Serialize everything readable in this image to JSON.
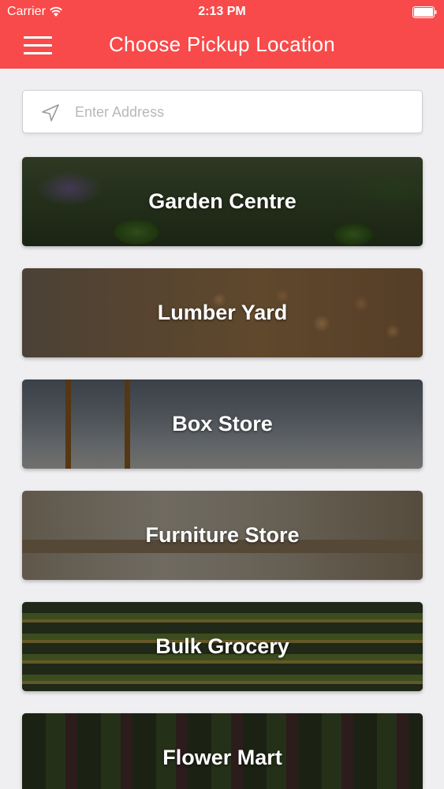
{
  "status_bar": {
    "carrier": "Carrier",
    "time": "2:13 PM"
  },
  "header": {
    "title": "Choose Pickup Location",
    "background_color": "#f84a4a"
  },
  "search": {
    "placeholder": "Enter Address",
    "value": "",
    "icon": "location-arrow-icon"
  },
  "locations": [
    {
      "label": "Garden Centre"
    },
    {
      "label": "Lumber Yard"
    },
    {
      "label": "Box Store"
    },
    {
      "label": "Furniture Store"
    },
    {
      "label": "Bulk Grocery"
    },
    {
      "label": "Flower Mart"
    }
  ]
}
